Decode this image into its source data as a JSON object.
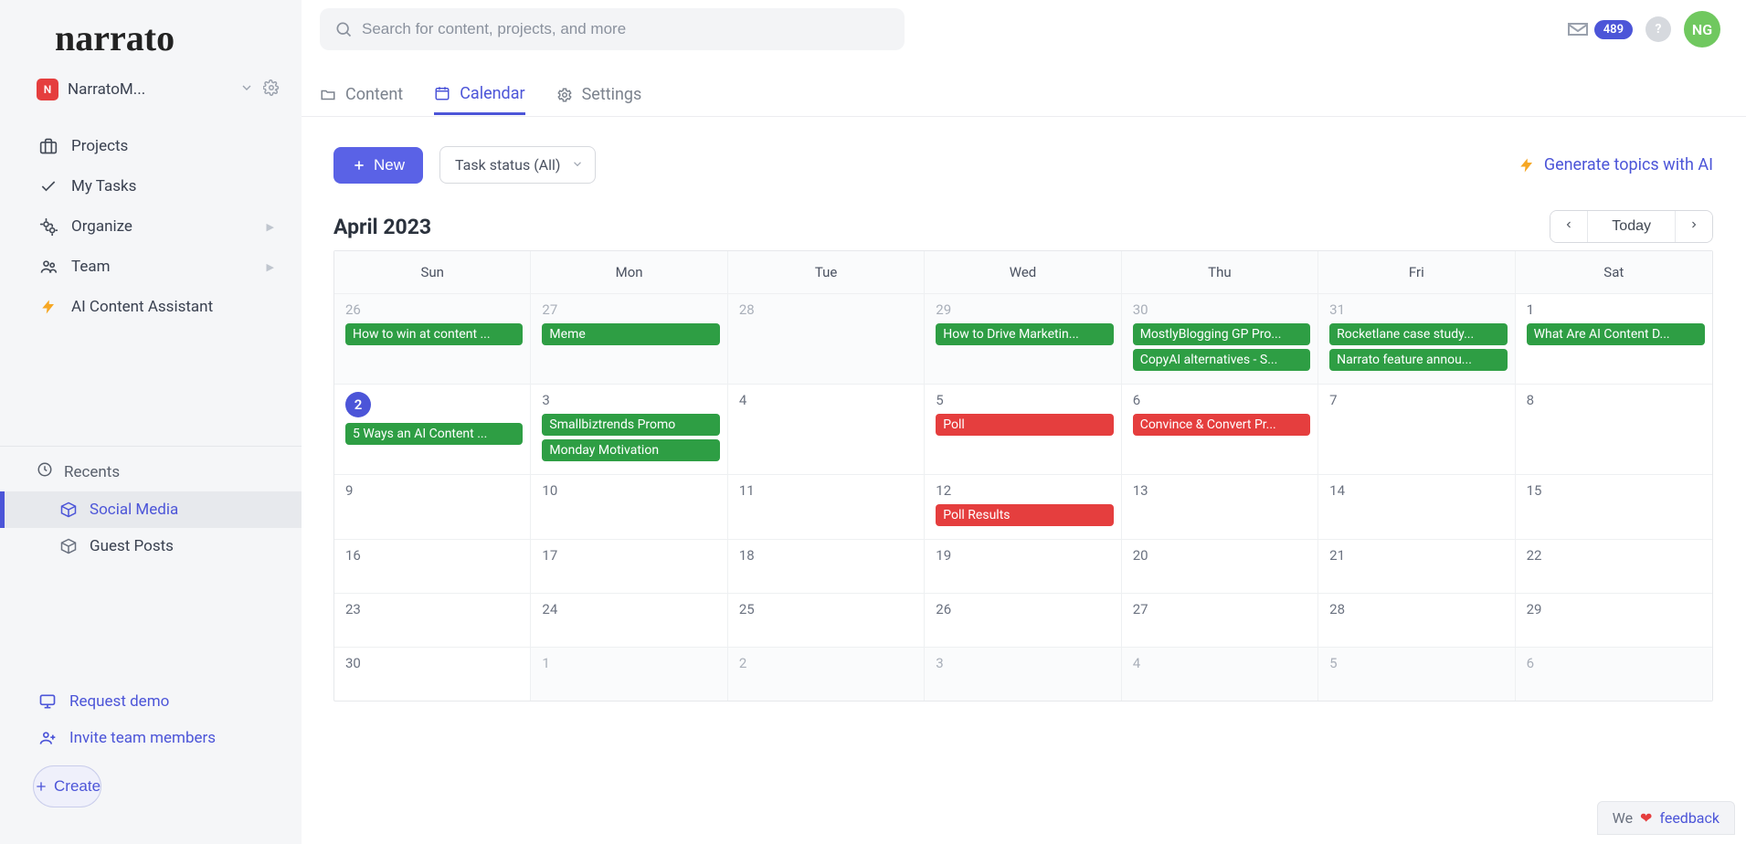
{
  "logo_text": "narrato",
  "workspace": {
    "initial": "N",
    "name": "NarratoM..."
  },
  "sidebar": {
    "projects": "Projects",
    "my_tasks": "My Tasks",
    "organize": "Organize",
    "team": "Team",
    "ai": "AI Content Assistant",
    "recents_label": "Recents",
    "recent1": "Social Media",
    "recent2": "Guest Posts",
    "request_demo": "Request demo",
    "invite": "Invite team members",
    "create": "Create"
  },
  "search": {
    "placeholder": "Search for content, projects, and more"
  },
  "header": {
    "badge": "489",
    "help": "?",
    "avatar": "NG"
  },
  "tabs": {
    "content": "Content",
    "calendar": "Calendar",
    "settings": "Settings"
  },
  "toolbar": {
    "new": "New",
    "status": "Task status (All)",
    "gen": "Generate topics with AI"
  },
  "calendar": {
    "month": "April 2023",
    "today": "Today",
    "dow": [
      "Sun",
      "Mon",
      "Tue",
      "Wed",
      "Thu",
      "Fri",
      "Sat"
    ]
  },
  "weeks": [
    [
      {
        "n": "26",
        "other": true,
        "events": [
          {
            "t": "How to win at content ...",
            "c": "green"
          }
        ]
      },
      {
        "n": "27",
        "other": true,
        "events": [
          {
            "t": "Meme",
            "c": "green"
          }
        ]
      },
      {
        "n": "28",
        "other": true,
        "events": []
      },
      {
        "n": "29",
        "other": true,
        "events": [
          {
            "t": "How to Drive Marketin...",
            "c": "green"
          }
        ]
      },
      {
        "n": "30",
        "other": true,
        "events": [
          {
            "t": "MostlyBlogging GP Pro...",
            "c": "green"
          },
          {
            "t": "CopyAI alternatives - S...",
            "c": "green"
          }
        ]
      },
      {
        "n": "31",
        "other": true,
        "events": [
          {
            "t": "Rocketlane case study...",
            "c": "green"
          },
          {
            "t": "Narrato feature annou...",
            "c": "green"
          }
        ]
      },
      {
        "n": "1",
        "events": [
          {
            "t": "What Are AI Content D...",
            "c": "green"
          }
        ]
      }
    ],
    [
      {
        "n": "2",
        "today": true,
        "events": [
          {
            "t": "5 Ways an AI Content ...",
            "c": "green"
          }
        ]
      },
      {
        "n": "3",
        "events": [
          {
            "t": "Smallbiztrends Promo",
            "c": "green"
          },
          {
            "t": "Monday Motivation",
            "c": "green"
          }
        ]
      },
      {
        "n": "4",
        "events": []
      },
      {
        "n": "5",
        "events": [
          {
            "t": "Poll",
            "c": "red"
          }
        ]
      },
      {
        "n": "6",
        "events": [
          {
            "t": "Convince & Convert Pr...",
            "c": "red"
          }
        ]
      },
      {
        "n": "7",
        "events": []
      },
      {
        "n": "8",
        "events": []
      }
    ],
    [
      {
        "n": "9",
        "events": []
      },
      {
        "n": "10",
        "events": []
      },
      {
        "n": "11",
        "events": []
      },
      {
        "n": "12",
        "events": [
          {
            "t": "Poll Results",
            "c": "red"
          }
        ]
      },
      {
        "n": "13",
        "events": []
      },
      {
        "n": "14",
        "events": []
      },
      {
        "n": "15",
        "events": []
      }
    ],
    [
      {
        "n": "16",
        "events": []
      },
      {
        "n": "17",
        "events": []
      },
      {
        "n": "18",
        "events": []
      },
      {
        "n": "19",
        "events": []
      },
      {
        "n": "20",
        "events": []
      },
      {
        "n": "21",
        "events": []
      },
      {
        "n": "22",
        "events": []
      }
    ],
    [
      {
        "n": "23",
        "events": []
      },
      {
        "n": "24",
        "events": []
      },
      {
        "n": "25",
        "events": []
      },
      {
        "n": "26",
        "events": []
      },
      {
        "n": "27",
        "events": []
      },
      {
        "n": "28",
        "events": []
      },
      {
        "n": "29",
        "events": []
      }
    ],
    [
      {
        "n": "30",
        "events": []
      },
      {
        "n": "1",
        "other": true,
        "events": []
      },
      {
        "n": "2",
        "other": true,
        "events": []
      },
      {
        "n": "3",
        "other": true,
        "events": []
      },
      {
        "n": "4",
        "other": true,
        "events": []
      },
      {
        "n": "5",
        "other": true,
        "events": []
      },
      {
        "n": "6",
        "other": true,
        "events": []
      }
    ]
  ],
  "feedback": {
    "we": "We",
    "text": "feedback"
  }
}
